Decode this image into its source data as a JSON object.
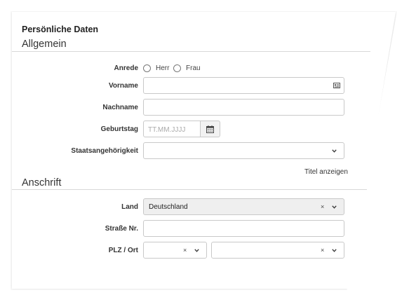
{
  "header": {
    "title": "Persönliche Daten"
  },
  "general": {
    "heading": "Allgemein",
    "salutation": {
      "label": "Anrede",
      "options": [
        "Herr",
        "Frau"
      ]
    },
    "firstname": {
      "label": "Vorname",
      "value": ""
    },
    "lastname": {
      "label": "Nachname",
      "value": ""
    },
    "birthday": {
      "label": "Geburtstag",
      "placeholder": "TT.MM.JJJJ"
    },
    "nationality": {
      "label": "Staatsangehörigkeit",
      "value": ""
    },
    "show_title_link": "Titel anzeigen"
  },
  "address": {
    "heading": "Anschrift",
    "country": {
      "label": "Land",
      "value": "Deutschland"
    },
    "street": {
      "label": "Straße Nr.",
      "value": ""
    },
    "zip_city": {
      "label": "PLZ / Ort",
      "zip_value": "",
      "city_value": ""
    }
  },
  "icons": {
    "contact_card": "contact-card-icon",
    "calendar": "calendar-icon",
    "chevron": "chevron-down-icon",
    "clear": "clear-x-icon"
  }
}
